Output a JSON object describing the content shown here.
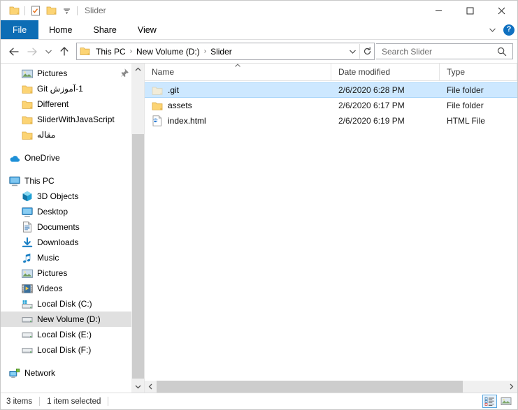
{
  "window": {
    "title": "Slider",
    "quick_access": [
      {
        "name": "folder-icon",
        "label": "Folder"
      },
      {
        "name": "properties-icon",
        "label": "Properties"
      },
      {
        "name": "new-folder-icon",
        "label": "New folder"
      },
      {
        "name": "customize-chevron-icon",
        "label": "Customize Quick Access Toolbar"
      }
    ],
    "controls": {
      "minimize": "—",
      "maximize": "☐",
      "close": "✕"
    }
  },
  "ribbon": {
    "tabs": [
      {
        "label": "File",
        "active": true
      },
      {
        "label": "Home",
        "active": false
      },
      {
        "label": "Share",
        "active": false
      },
      {
        "label": "View",
        "active": false
      }
    ],
    "collapse_icon": "chevron-down-icon",
    "help_label": "?"
  },
  "address": {
    "back_icon": "←",
    "forward_icon": "→",
    "recent_icon": "⌄",
    "up_icon": "↑",
    "crumbs": [
      "This PC",
      "New Volume (D:)",
      "Slider"
    ],
    "separator": "›",
    "dropdown_icon": "⌄",
    "refresh_icon": "↻"
  },
  "search": {
    "placeholder": "Search Slider",
    "value": "",
    "icon": "search-icon"
  },
  "sidebar": {
    "groups": [
      {
        "items": [
          {
            "label": "Pictures",
            "icon": "pictures-icon",
            "pinned": true,
            "indent": 1,
            "selected": false
          },
          {
            "label": "1-آموزش Git",
            "icon": "folder-icon",
            "pinned": false,
            "indent": 1,
            "selected": false,
            "rtl": true
          },
          {
            "label": "Different",
            "icon": "folder-icon",
            "pinned": false,
            "indent": 1,
            "selected": false
          },
          {
            "label": "SliderWithJavaScript",
            "icon": "folder-icon",
            "pinned": false,
            "indent": 1,
            "selected": false
          },
          {
            "label": "مقاله",
            "icon": "folder-icon",
            "pinned": false,
            "indent": 1,
            "selected": false,
            "rtl": true
          }
        ]
      },
      {
        "items": [
          {
            "label": "OneDrive",
            "icon": "onedrive-icon",
            "pinned": false,
            "indent": 0,
            "selected": false
          }
        ]
      },
      {
        "items": [
          {
            "label": "This PC",
            "icon": "this-pc-icon",
            "pinned": false,
            "indent": 0,
            "selected": false
          },
          {
            "label": "3D Objects",
            "icon": "3d-objects-icon",
            "pinned": false,
            "indent": 1,
            "selected": false
          },
          {
            "label": "Desktop",
            "icon": "desktop-icon",
            "pinned": false,
            "indent": 1,
            "selected": false
          },
          {
            "label": "Documents",
            "icon": "documents-icon",
            "pinned": false,
            "indent": 1,
            "selected": false
          },
          {
            "label": "Downloads",
            "icon": "downloads-icon",
            "pinned": false,
            "indent": 1,
            "selected": false
          },
          {
            "label": "Music",
            "icon": "music-icon",
            "pinned": false,
            "indent": 1,
            "selected": false
          },
          {
            "label": "Pictures",
            "icon": "pictures-icon",
            "pinned": false,
            "indent": 1,
            "selected": false
          },
          {
            "label": "Videos",
            "icon": "videos-icon",
            "pinned": false,
            "indent": 1,
            "selected": false
          },
          {
            "label": "Local Disk (C:)",
            "icon": "system-drive-icon",
            "pinned": false,
            "indent": 1,
            "selected": false
          },
          {
            "label": "New Volume (D:)",
            "icon": "drive-icon",
            "pinned": false,
            "indent": 1,
            "selected": true
          },
          {
            "label": "Local Disk (E:)",
            "icon": "drive-icon",
            "pinned": false,
            "indent": 1,
            "selected": false
          },
          {
            "label": "Local Disk (F:)",
            "icon": "drive-icon",
            "pinned": false,
            "indent": 1,
            "selected": false
          }
        ]
      },
      {
        "items": [
          {
            "label": "Network",
            "icon": "network-icon",
            "pinned": false,
            "indent": 0,
            "selected": false
          }
        ]
      }
    ]
  },
  "filelist": {
    "columns": [
      {
        "label": "Name",
        "sorted": "asc"
      },
      {
        "label": "Date modified",
        "sorted": ""
      },
      {
        "label": "Type",
        "sorted": ""
      }
    ],
    "rows": [
      {
        "name": ".git",
        "date": "2/6/2020 6:28 PM",
        "type": "File folder",
        "icon": "folder-hidden-icon",
        "selected": true
      },
      {
        "name": "assets",
        "date": "2/6/2020 6:17 PM",
        "type": "File folder",
        "icon": "folder-icon",
        "selected": false
      },
      {
        "name": "index.html",
        "date": "2/6/2020 6:19 PM",
        "type": "HTML File",
        "icon": "html-file-icon",
        "selected": false
      }
    ]
  },
  "status": {
    "item_count": "3 items",
    "selection": "1 item selected",
    "views": [
      {
        "name": "details-view-button",
        "active": true
      },
      {
        "name": "large-icons-view-button",
        "active": false
      }
    ]
  },
  "colors": {
    "accent": "#0d6db5",
    "selection": "#cde8ff",
    "folder": "#fcd474",
    "nav_selection": "#e0e0e0"
  }
}
